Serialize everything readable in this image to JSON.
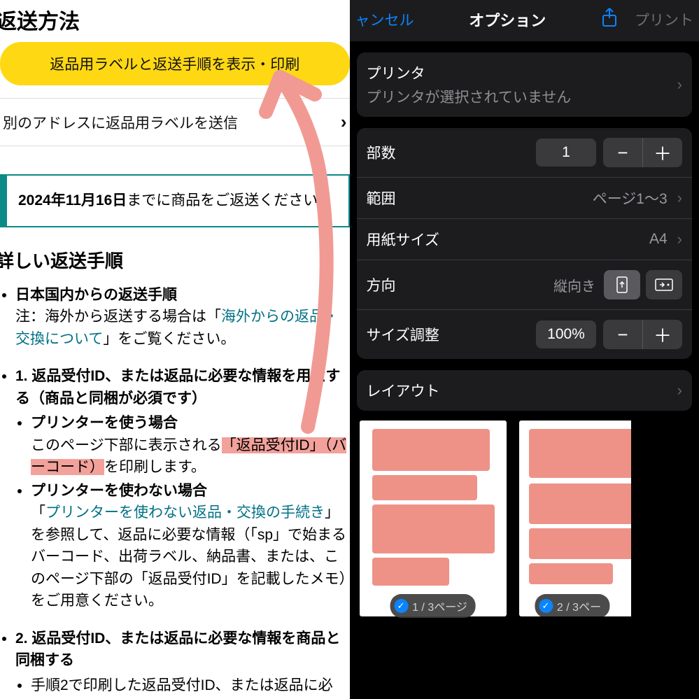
{
  "left": {
    "title": "返送方法",
    "yellow_button": "返品用ラベルと返送手順を表示・印刷",
    "send_label_row": "別のアドレスに返品用ラベルを送信",
    "deadline_date": "2024年11月16日",
    "deadline_rest": "までに商品をご返送ください。",
    "detail_heading": "詳しい返送手順",
    "domestic_heading": "日本国内からの返送手順",
    "note_prefix": "注：海外から返送する場合は「",
    "overseas_link": "海外からの返品・交換について",
    "note_suffix": "」をご覧ください。",
    "step1_heading": "1. 返品受付ID、または返品に必要な情報を用意する（商品と同梱が必須です）",
    "printer_case": "プリンターを使う場合",
    "printer_text_a": "このページ下部に表示される",
    "printer_hl": "「返品受付ID」（バーコード）",
    "printer_text_b": "を印刷します。",
    "noprinter_case": "プリンターを使わない場合",
    "noprinter_link": "プリンターを使わない返品・交換の手続き",
    "noprinter_rest": "」を参照して、返品に必要な情報（「sp」で始まるバーコード、出荷ラベル、納品書、または、このページ下部の「返品受付ID」を記載したメモ）をご用意ください。",
    "step2_heading": "2. 返品受付ID、または返品に必要な情報を商品と同梱する",
    "step2_text": "手順2で印刷した返品受付ID、または返品に必"
  },
  "right": {
    "cancel": "ャンセル",
    "title": "オプション",
    "print_btn": "プリント",
    "printer_label": "プリンタ",
    "printer_value": "プリンタが選択されていません",
    "copies_label": "部数",
    "copies_value": "1",
    "range_label": "範囲",
    "range_value": "ページ1〜3",
    "paper_label": "用紙サイズ",
    "paper_value": "A4",
    "orientation_label": "方向",
    "orientation_value": "縦向き",
    "scale_label": "サイズ調整",
    "scale_value": "100%",
    "layout_label": "レイアウト",
    "page1_badge": "1 / 3ページ",
    "page2_badge": "2 / 3ペー"
  }
}
